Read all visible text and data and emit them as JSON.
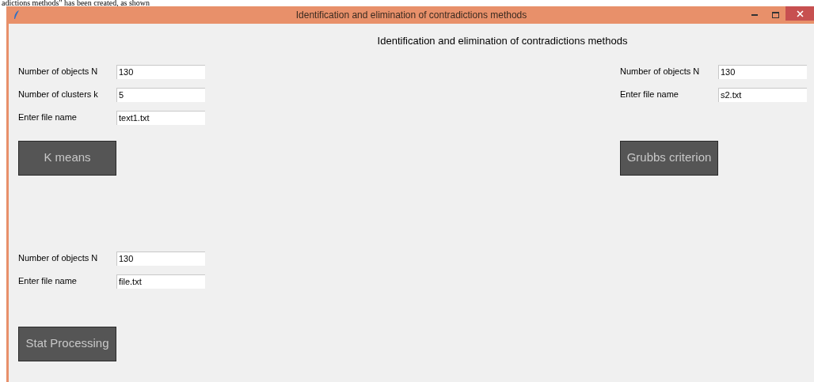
{
  "caption": "adictions methods\" has been created, as shown",
  "window": {
    "title": "Identification and elimination of contradictions methods"
  },
  "heading": "Identification and elimination of contradictions methods",
  "panels": [
    {
      "fields": [
        {
          "label": "Number of objects N",
          "value": "130"
        },
        {
          "label": "Number of clusters k",
          "value": "5"
        },
        {
          "label": "Enter file name",
          "value": "text1.txt"
        }
      ],
      "button": "K means"
    },
    {
      "fields": [
        {
          "label": "Number of objects N",
          "value": "130"
        },
        {
          "label": "Enter file name",
          "value": "s2.txt"
        }
      ],
      "button": "Grubbs criterion"
    },
    {
      "fields": [
        {
          "label": "Number of objects N",
          "value": "130"
        },
        {
          "label": "Enter file name",
          "value": "file.txt"
        }
      ],
      "button": "Stat Processing"
    }
  ]
}
